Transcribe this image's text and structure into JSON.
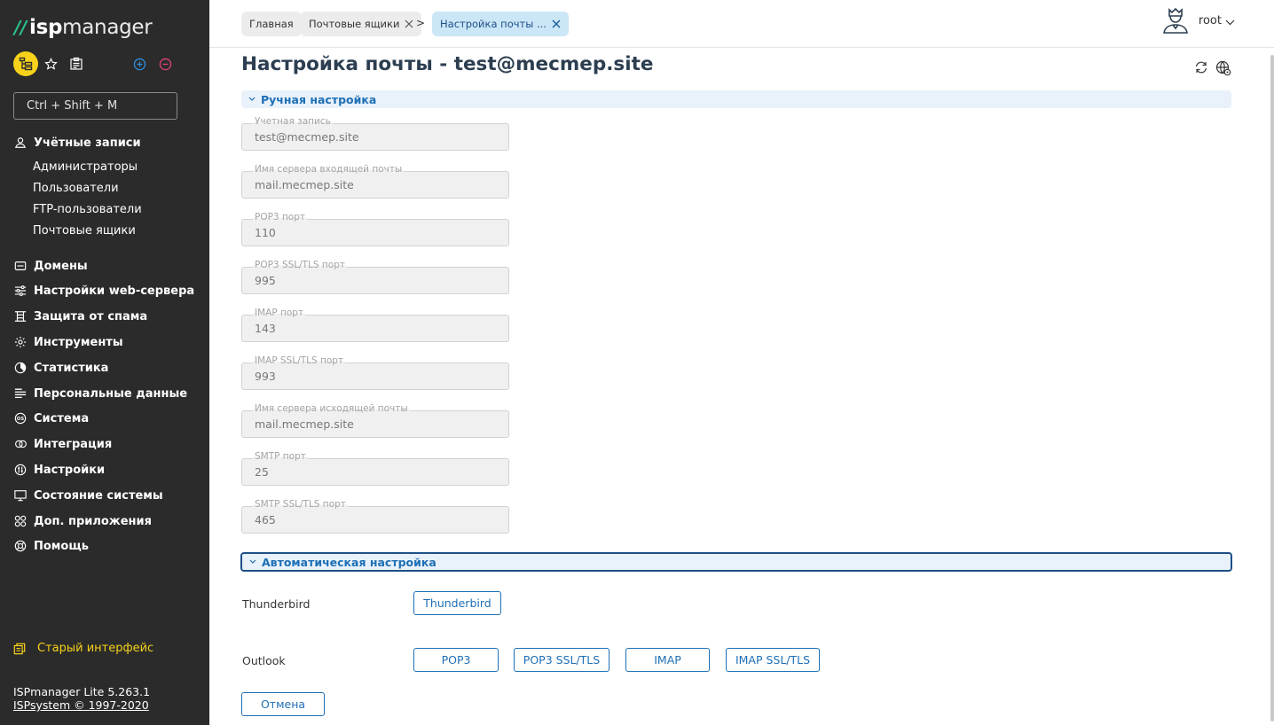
{
  "sidebar": {
    "logo": {
      "slashes": "//",
      "isp": "isp",
      "manager": "manager"
    },
    "search_placeholder": "Ctrl + Shift + M",
    "sections": [
      {
        "label": "Учётные записи",
        "icon": "users-icon"
      },
      {
        "label": "Домены",
        "icon": "domains-icon"
      },
      {
        "label": "Настройки web-сервера",
        "icon": "sliders-icon"
      },
      {
        "label": "Защита от спама",
        "icon": "spam-icon"
      },
      {
        "label": "Инструменты",
        "icon": "gear-icon"
      },
      {
        "label": "Статистика",
        "icon": "pie-chart-icon"
      },
      {
        "label": "Персональные данные",
        "icon": "personal-data-icon"
      },
      {
        "label": "Система",
        "icon": "os-icon"
      },
      {
        "label": "Интеграция",
        "icon": "integration-icon"
      },
      {
        "label": "Настройки",
        "icon": "settings-icon"
      },
      {
        "label": "Состояние системы",
        "icon": "monitor-icon"
      },
      {
        "label": "Доп. приложения",
        "icon": "apps-icon"
      },
      {
        "label": "Помощь",
        "icon": "help-icon"
      }
    ],
    "subitems": [
      "Администраторы",
      "Пользователи",
      "FTP-пользователи",
      "Почтовые ящики"
    ],
    "old_interface": "Старый интерфейс",
    "version": "ISPmanager Lite 5.263.1",
    "copyright": "ISPsystem © 1997-2020"
  },
  "header": {
    "breadcrumbs": [
      {
        "label": "Главная"
      },
      {
        "label": "Почтовые ящики"
      },
      {
        "label": "Настройка почты ..."
      }
    ],
    "separator": ">",
    "user": "root"
  },
  "main": {
    "title": "Настройка почты - test@mecmep.site",
    "manual_section": "Ручная настройка",
    "fields": [
      {
        "label": "Учетная запись",
        "value": "test@mecmep.site"
      },
      {
        "label": "Имя сервера входящей почты",
        "value": "mail.mecmep.site"
      },
      {
        "label": "POP3 порт",
        "value": "110"
      },
      {
        "label": "POP3 SSL/TLS порт",
        "value": "995"
      },
      {
        "label": "IMAP порт",
        "value": "143"
      },
      {
        "label": "IMAP SSL/TLS порт",
        "value": "993"
      },
      {
        "label": "Имя сервера исходящей почты",
        "value": "mail.mecmep.site"
      },
      {
        "label": "SMTP порт",
        "value": "25"
      },
      {
        "label": "SMTP SSL/TLS порт",
        "value": "465"
      }
    ],
    "auto_section": "Автоматическая настройка",
    "thunderbird_label": "Thunderbird",
    "thunderbird_button": "Thunderbird",
    "outlook_label": "Outlook",
    "outlook_buttons": [
      "POP3",
      "POP3 SSL/TLS",
      "IMAP",
      "IMAP SSL/TLS"
    ],
    "cancel_button": "Отмена"
  },
  "colors": {
    "sidebar_bg": "#2b2b2b",
    "accent": "#1e6fb6",
    "yellow": "#f6d21a"
  }
}
